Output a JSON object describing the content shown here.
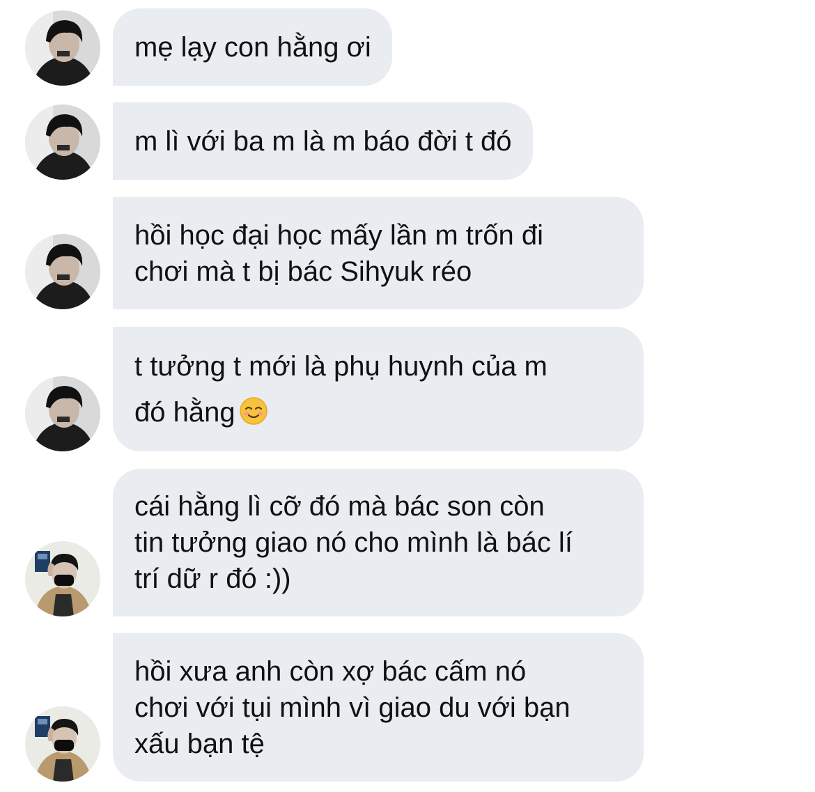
{
  "conversation": {
    "messages": [
      {
        "sender": "contact-a",
        "lines": [
          "mẹ lạy con hằng ơi"
        ]
      },
      {
        "sender": "contact-a",
        "lines": [
          "m lì với ba m là m báo đời t đó"
        ]
      },
      {
        "sender": "contact-a",
        "lines": [
          "hồi học đại học mấy lần m trốn đi",
          "chơi mà t bị bác Sihyuk réo"
        ]
      },
      {
        "sender": "contact-a",
        "lines": [
          "t tưởng t mới là phụ huynh của m",
          "đó hằng"
        ],
        "emoji": "smiling-face-icon"
      },
      {
        "sender": "contact-b",
        "lines": [
          "cái hằng lì cỡ đó mà bác son còn",
          "tin tưởng giao nó cho mình là bác lí",
          "trí dữ r đó :))"
        ]
      },
      {
        "sender": "contact-b",
        "lines": [
          "hồi xưa anh còn xợ bác cấm nó",
          "chơi với tụi mình vì giao du với bạn",
          "xấu bạn tệ"
        ]
      }
    ]
  },
  "colors": {
    "bubble_bg": "#e9ecf0",
    "text": "#111111",
    "background": "#ffffff"
  }
}
